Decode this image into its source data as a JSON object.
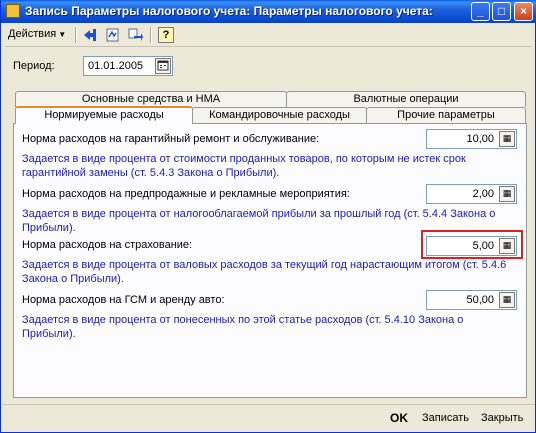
{
  "window": {
    "title": "Запись Параметры налогового учета: Параметры налогового учета:",
    "minimize": "_",
    "maximize": "□",
    "close": "×"
  },
  "toolbar": {
    "actions_label": "Действия",
    "actions_arrow": "▼",
    "help_icon_glyph": "?"
  },
  "period": {
    "label": "Период:",
    "value": "01.01.2005"
  },
  "tabs": {
    "top": [
      {
        "label": "Основные средства и НМА"
      },
      {
        "label": "Валютные операции"
      }
    ],
    "bottom": [
      {
        "label": "Нормируемые расходы"
      },
      {
        "label": "Командировочные расходы"
      },
      {
        "label": "Прочие параметры"
      }
    ],
    "active_tab": "Нормируемые расходы"
  },
  "norms": [
    {
      "label": "Норма расходов на гарантийный ремонт и обслуживание:",
      "value": "10,00",
      "description": "Задается в виде процента от стоимости проданных товаров, по которым не истек срок гарантийной замены (ст. 5.4.3 Закона о Прибыли)."
    },
    {
      "label": "Норма расходов на предпродажные и рекламные мероприятия:",
      "value": "2,00",
      "description": "Задается в виде процента от налогооблагаемой прибыли за прошлый год (ст. 5.4.4 Закона о Прибыли)."
    },
    {
      "label": "Норма расходов на страхование:",
      "value": "5,00",
      "description": "Задается в виде процента от валовых расходов за текущий год нарастающим итогом (ст. 5.4.6 Закона о Прибыли)."
    },
    {
      "label": "Норма расходов на ГСМ и аренду авто:",
      "value": "50,00",
      "description": "Задается в виде процента от понесенных по этой статье расходов (ст. 5.4.10 Закона о Прибыли)."
    }
  ],
  "buttons": {
    "ok": "OK",
    "save": "Записать",
    "close": "Закрыть"
  },
  "colors": {
    "titlebar": "#0b4ad0",
    "description_text": "#1a1ac8",
    "highlight": "#e02020",
    "active_tab_accent": "#e68b2c"
  }
}
